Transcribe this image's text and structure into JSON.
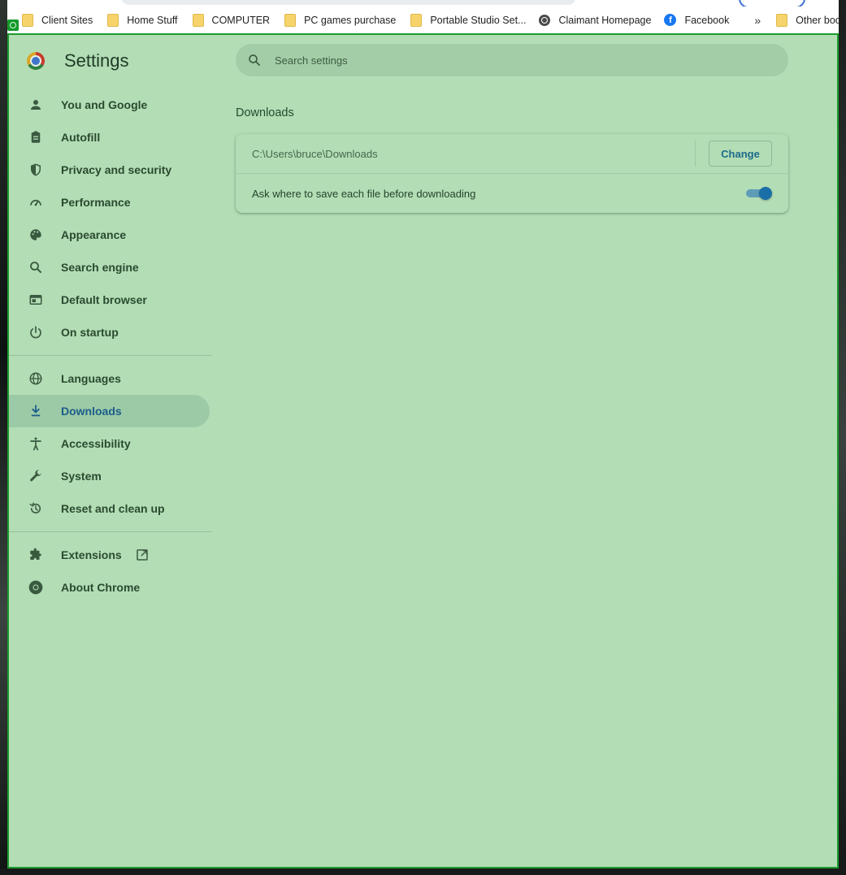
{
  "bookmarks": [
    {
      "label": "Client Sites",
      "icon": "folder-icon"
    },
    {
      "label": "Home Stuff",
      "icon": "folder-icon"
    },
    {
      "label": "COMPUTER",
      "icon": "folder-icon"
    },
    {
      "label": "PC games purchase",
      "icon": "folder-icon"
    },
    {
      "label": "Portable Studio Set...",
      "icon": "folder-icon"
    },
    {
      "label": "Claimant Homepage",
      "icon": "globe-icon"
    },
    {
      "label": "Facebook",
      "icon": "facebook-icon"
    }
  ],
  "bookmarks_overflow": "»",
  "other_bookmarks": "Other bookmarks",
  "settings": {
    "title": "Settings",
    "search_placeholder": "Search settings"
  },
  "nav": {
    "group1": [
      {
        "label": "You and Google",
        "icon": "person-icon"
      },
      {
        "label": "Autofill",
        "icon": "clipboard-icon"
      },
      {
        "label": "Privacy and security",
        "icon": "shield-icon"
      },
      {
        "label": "Performance",
        "icon": "speedometer-icon"
      },
      {
        "label": "Appearance",
        "icon": "palette-icon"
      },
      {
        "label": "Search engine",
        "icon": "search-icon"
      },
      {
        "label": "Default browser",
        "icon": "browser-window-icon"
      },
      {
        "label": "On startup",
        "icon": "power-icon"
      }
    ],
    "group2": [
      {
        "label": "Languages",
        "icon": "globe-icon"
      },
      {
        "label": "Downloads",
        "icon": "download-icon",
        "active": true
      },
      {
        "label": "Accessibility",
        "icon": "accessibility-icon"
      },
      {
        "label": "System",
        "icon": "wrench-icon"
      },
      {
        "label": "Reset and clean up",
        "icon": "restore-icon"
      }
    ],
    "group3": [
      {
        "label": "Extensions",
        "icon": "puzzle-icon"
      },
      {
        "label": "About Chrome",
        "icon": "chrome-icon"
      }
    ]
  },
  "downloads": {
    "section_title": "Downloads",
    "location_path": "C:\\Users\\bruce\\Downloads",
    "change_label": "Change",
    "ask_label": "Ask where to save each file before downloading",
    "ask_enabled": true
  },
  "colors": {
    "overlay_green": "#b3ddb5",
    "active_accent": "#1b5e8a",
    "toggle_on": "#1a6fa8"
  }
}
